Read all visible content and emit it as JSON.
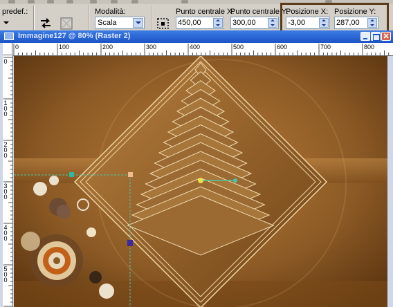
{
  "toolbar": {
    "preset_label": "predef.:",
    "mode_label": "Modalità:",
    "mode_value": "Scala",
    "center_x_label": "Punto centrale X:",
    "center_x_value": "450,00",
    "center_y_label": "Punto centrale Y:",
    "center_y_value": "300,00",
    "pos_x_label": "Posizione X:",
    "pos_x_value": "-3,00",
    "pos_y_label": "Posizione Y:",
    "pos_y_value": "287,00"
  },
  "window": {
    "title": "Immagine127 @ 80% (Raster 2)"
  },
  "ruler": {
    "h_ticks": [
      "0",
      "100",
      "200",
      "300",
      "400",
      "500",
      "600",
      "700",
      "800"
    ],
    "v_ticks": [
      "0",
      "100",
      "200",
      "300",
      "400",
      "500"
    ]
  },
  "colors": {
    "toolbar_bg": "#d4d0c8",
    "title_blue": "#2458d0",
    "canvas_brown": "#8a5a22",
    "highlight_border": "#5a3c1b"
  }
}
